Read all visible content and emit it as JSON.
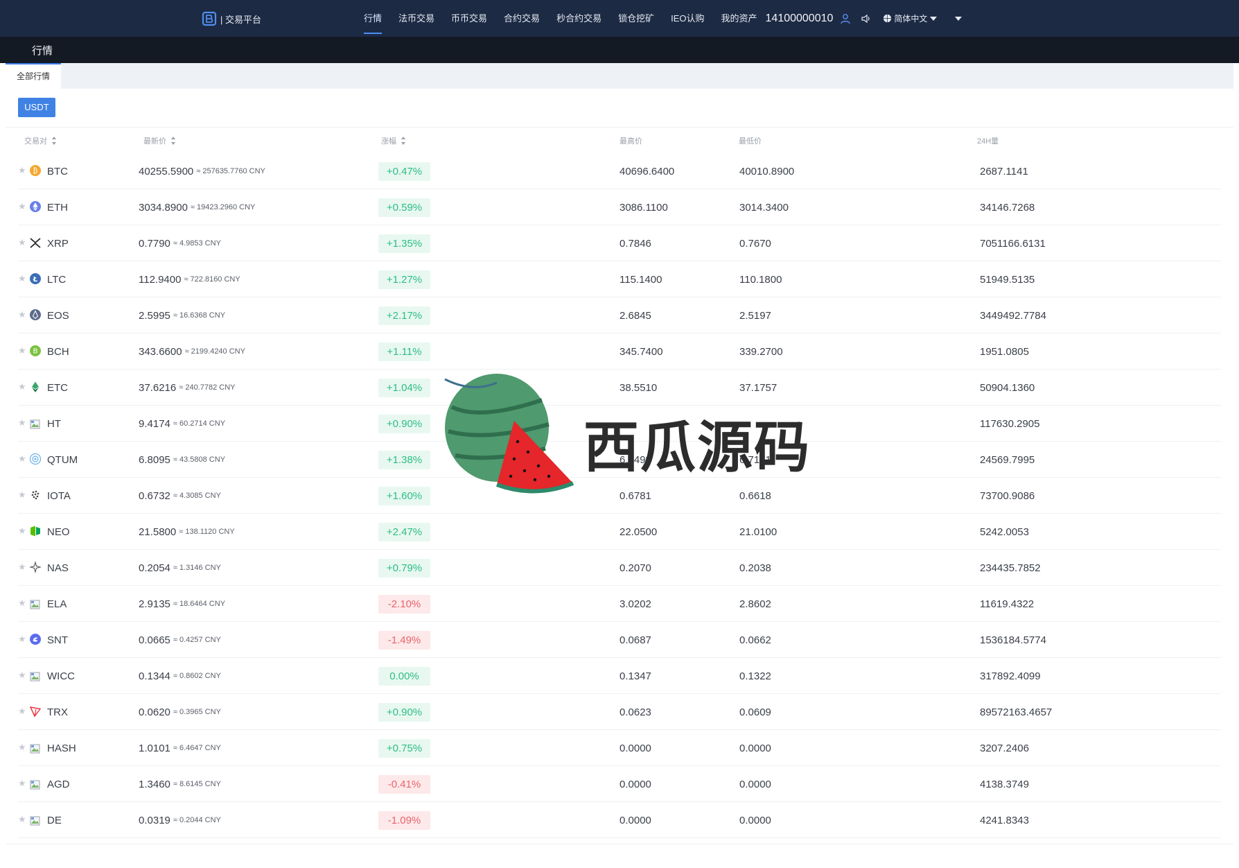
{
  "nav": {
    "logo_text": "| 交易平台",
    "items": [
      {
        "label": "行情",
        "active": true
      },
      {
        "label": "法币交易"
      },
      {
        "label": "币币交易"
      },
      {
        "label": "合约交易"
      },
      {
        "label": "秒合约交易"
      },
      {
        "label": "锁仓挖矿"
      },
      {
        "label": "IEO认购"
      },
      {
        "label": "我的资产"
      }
    ],
    "user_id": "14100000010",
    "language": "简体中文"
  },
  "section": {
    "title": "行情",
    "tab_all": "全部行情",
    "quote_button": "USDT"
  },
  "table": {
    "headers": {
      "pair": "交易对",
      "last": "最新价",
      "change": "涨幅",
      "high": "最高价",
      "low": "最低价",
      "volume": "24H量"
    },
    "rows": [
      {
        "pair": "BTC",
        "icon": "btc-icon",
        "price": "40255.5900",
        "cny": "≈ 257635.7760 CNY",
        "change": "+0.47%",
        "dir": "up",
        "high": "40696.6400",
        "low": "40010.8900",
        "vol": "2687.1141"
      },
      {
        "pair": "ETH",
        "icon": "eth-icon",
        "price": "3034.8900",
        "cny": "≈ 19423.2960 CNY",
        "change": "+0.59%",
        "dir": "up",
        "high": "3086.1100",
        "low": "3014.3400",
        "vol": "34146.7268"
      },
      {
        "pair": "XRP",
        "icon": "xrp-icon",
        "price": "0.7790",
        "cny": "≈ 4.9853 CNY",
        "change": "+1.35%",
        "dir": "up",
        "high": "0.7846",
        "low": "0.7670",
        "vol": "7051166.6131"
      },
      {
        "pair": "LTC",
        "icon": "ltc-icon",
        "price": "112.9400",
        "cny": "≈ 722.8160 CNY",
        "change": "+1.27%",
        "dir": "up",
        "high": "115.1400",
        "low": "110.1800",
        "vol": "51949.5135"
      },
      {
        "pair": "EOS",
        "icon": "eos-icon",
        "price": "2.5995",
        "cny": "≈ 16.6368 CNY",
        "change": "+2.17%",
        "dir": "up",
        "high": "2.6845",
        "low": "2.5197",
        "vol": "3449492.7784"
      },
      {
        "pair": "BCH",
        "icon": "bch-icon",
        "price": "343.6600",
        "cny": "≈ 2199.4240 CNY",
        "change": "+1.11%",
        "dir": "up",
        "high": "345.7400",
        "low": "339.2700",
        "vol": "1951.0805"
      },
      {
        "pair": "ETC",
        "icon": "etc-icon",
        "price": "37.6216",
        "cny": "≈ 240.7782 CNY",
        "change": "+1.04%",
        "dir": "up",
        "high": "38.5510",
        "low": "37.1757",
        "vol": "50904.1360"
      },
      {
        "pair": "HT",
        "icon": "broken-image-icon",
        "price": "9.4174",
        "cny": "≈ 60.2714 CNY",
        "change": "+0.90%",
        "dir": "up",
        "high": "",
        "low": "",
        "vol": "117630.2905"
      },
      {
        "pair": "QTUM",
        "icon": "qtum-icon",
        "price": "6.8095",
        "cny": "≈ 43.5808 CNY",
        "change": "+1.38%",
        "dir": "up",
        "high": "6.9499",
        "low": "6.7171",
        "vol": "24569.7995"
      },
      {
        "pair": "IOTA",
        "icon": "iota-icon",
        "price": "0.6732",
        "cny": "≈ 4.3085 CNY",
        "change": "+1.60%",
        "dir": "up",
        "high": "0.6781",
        "low": "0.6618",
        "vol": "73700.9086"
      },
      {
        "pair": "NEO",
        "icon": "neo-icon",
        "price": "21.5800",
        "cny": "≈ 138.1120 CNY",
        "change": "+2.47%",
        "dir": "up",
        "high": "22.0500",
        "low": "21.0100",
        "vol": "5242.0053"
      },
      {
        "pair": "NAS",
        "icon": "nas-icon",
        "price": "0.2054",
        "cny": "≈ 1.3146 CNY",
        "change": "+0.79%",
        "dir": "up",
        "high": "0.2070",
        "low": "0.2038",
        "vol": "234435.7852"
      },
      {
        "pair": "ELA",
        "icon": "broken-image-icon",
        "price": "2.9135",
        "cny": "≈ 18.6464 CNY",
        "change": "-2.10%",
        "dir": "down",
        "high": "3.0202",
        "low": "2.8602",
        "vol": "11619.4322"
      },
      {
        "pair": "SNT",
        "icon": "snt-icon",
        "price": "0.0665",
        "cny": "≈ 0.4257 CNY",
        "change": "-1.49%",
        "dir": "down",
        "high": "0.0687",
        "low": "0.0662",
        "vol": "1536184.5774"
      },
      {
        "pair": "WICC",
        "icon": "broken-image-icon",
        "price": "0.1344",
        "cny": "≈ 0.8602 CNY",
        "change": "0.00%",
        "dir": "up",
        "high": "0.1347",
        "low": "0.1322",
        "vol": "317892.4099"
      },
      {
        "pair": "TRX",
        "icon": "trx-icon",
        "price": "0.0620",
        "cny": "≈ 0.3965 CNY",
        "change": "+0.90%",
        "dir": "up",
        "high": "0.0623",
        "low": "0.0609",
        "vol": "89572163.4657"
      },
      {
        "pair": "HASH",
        "icon": "broken-image-icon",
        "price": "1.0101",
        "cny": "≈ 6.4647 CNY",
        "change": "+0.75%",
        "dir": "up",
        "high": "0.0000",
        "low": "0.0000",
        "vol": "3207.2406"
      },
      {
        "pair": "AGD",
        "icon": "broken-image-icon",
        "price": "1.3460",
        "cny": "≈ 8.6145 CNY",
        "change": "-0.41%",
        "dir": "down",
        "high": "0.0000",
        "low": "0.0000",
        "vol": "4138.3749"
      },
      {
        "pair": "DE",
        "icon": "broken-image-icon",
        "price": "0.0319",
        "cny": "≈ 0.2044 CNY",
        "change": "-1.09%",
        "dir": "down",
        "high": "0.0000",
        "low": "0.0000",
        "vol": "4241.8343"
      }
    ]
  },
  "watermark": {
    "text": "西瓜源码"
  },
  "colors": {
    "up": "#2dbd85",
    "down": "#e8646c",
    "accent": "#3f82e4",
    "topbar": "#1d2a44"
  }
}
